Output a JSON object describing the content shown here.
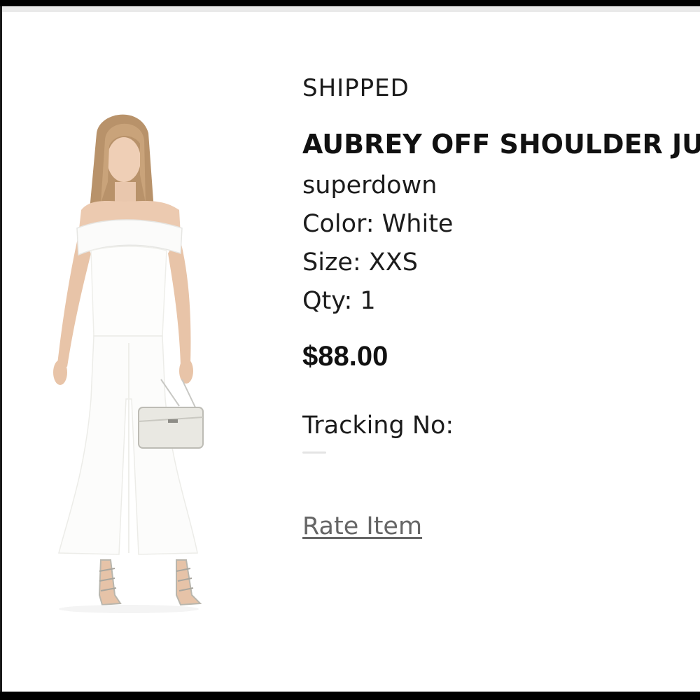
{
  "order_item": {
    "status": "SHIPPED",
    "product_name": "AUBREY OFF SHOULDER JUMPSUIT",
    "brand": "superdown",
    "color_line": "Color: White",
    "size_line": "Size: XXS",
    "qty_line": "Qty: 1",
    "price": "$88.00",
    "tracking_label": "Tracking No:",
    "rate_item_label": "Rate Item"
  },
  "image": {
    "icon": "product-photo-white-jumpsuit"
  }
}
